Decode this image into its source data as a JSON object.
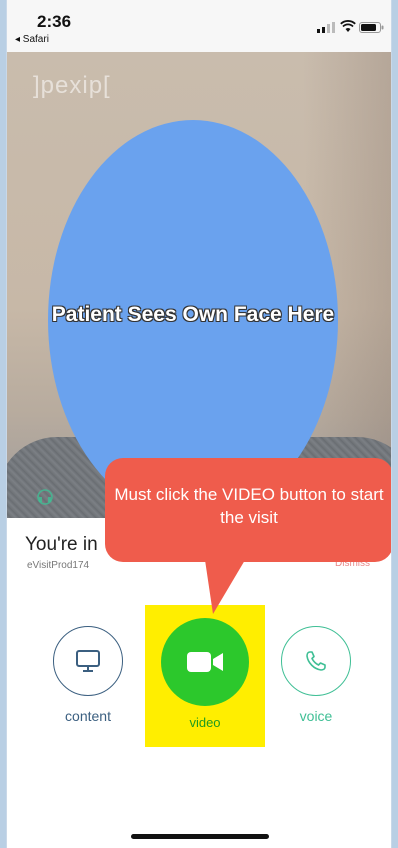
{
  "status_bar": {
    "time": "2:36",
    "back_label": "◂ Safari",
    "icons": [
      "signal-icon",
      "wifi-icon",
      "battery-icon"
    ]
  },
  "camera": {
    "brand": "]pexip[",
    "self_view_label": "Patient Sees Own Face Here",
    "self_view_color": "#6aa2ee"
  },
  "meeting": {
    "title": "You're in",
    "conference_name": "eVisitProd174",
    "dismiss_label": "Dismiss"
  },
  "controls": [
    {
      "label": "content",
      "icon": "monitor-icon",
      "color": "#3b5f80"
    },
    {
      "label": "video",
      "icon": "video-camera-icon",
      "color": "#2cc82c"
    },
    {
      "label": "voice",
      "icon": "phone-icon",
      "color": "#3fbf95"
    }
  ],
  "annotation": {
    "callout_text": "Must click the VIDEO button to start the visit",
    "callout_color": "#ef5c4c",
    "highlight_color": "#ffee00"
  }
}
